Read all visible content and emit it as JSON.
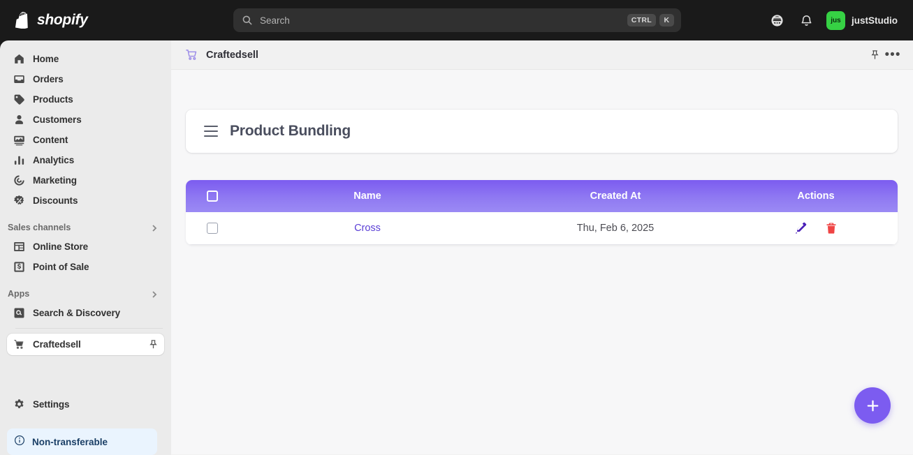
{
  "topbar": {
    "brand_name": "shopify",
    "brand_icon": "shopify-bag-logo",
    "search": {
      "placeholder": "Search",
      "icon": "search-icon",
      "kbd_ctrl": "CTRL",
      "kbd_key": "K"
    },
    "store_icon": "store-front-icon",
    "notifications_icon": "bell-icon",
    "user": {
      "initials": "jus",
      "name": "justStudio",
      "avatar_color": "#36d144"
    }
  },
  "sidebar": {
    "items": [
      {
        "label": "Home",
        "icon": "home-icon"
      },
      {
        "label": "Orders",
        "icon": "orders-inbox-icon"
      },
      {
        "label": "Products",
        "icon": "product-tag-icon"
      },
      {
        "label": "Customers",
        "icon": "person-icon"
      },
      {
        "label": "Content",
        "icon": "content-image-icon"
      },
      {
        "label": "Analytics",
        "icon": "bar-chart-icon"
      },
      {
        "label": "Marketing",
        "icon": "megaphone-target-icon"
      },
      {
        "label": "Discounts",
        "icon": "discount-percent-icon"
      }
    ],
    "sections": [
      {
        "title": "Sales channels",
        "chevron": "chevron-right-icon",
        "items": [
          {
            "label": "Online Store",
            "icon": "online-store-icon"
          },
          {
            "label": "Point of Sale",
            "icon": "point-of-sale-icon"
          }
        ]
      },
      {
        "title": "Apps",
        "chevron": "chevron-right-icon",
        "items": [
          {
            "label": "Search & Discovery",
            "icon": "search-square-icon"
          }
        ]
      }
    ],
    "active_app": {
      "label": "Craftedsell",
      "icon": "shopping-cart-icon",
      "pin_icon": "pin-icon"
    },
    "settings": {
      "label": "Settings",
      "icon": "gear-icon"
    },
    "banner": {
      "label": "Non-transferable",
      "icon": "info-circle-icon",
      "bg": "#eaf4fe",
      "fg": "#1b3f66"
    }
  },
  "content": {
    "breadcrumb": {
      "title": "Craftedsell",
      "icon": "shopping-cart-icon",
      "pin_icon": "pin-icon",
      "more_icon": "ellipsis-icon"
    },
    "page_card": {
      "title": "Product Bundling",
      "menu_icon": "hamburger-menu-icon"
    },
    "table": {
      "columns": [
        "",
        "Name",
        "Created At",
        "Actions"
      ],
      "header_gradient_from": "#7c5cf0",
      "header_gradient_to": "#9b8af4",
      "rows": [
        {
          "name": "Cross",
          "created_at": "Thu, Feb 6, 2025",
          "edit_icon": "pencil-icon",
          "delete_icon": "trash-icon",
          "edit_color": "#4b21b8",
          "delete_color": "#ef4444"
        }
      ]
    },
    "fab": {
      "icon": "plus-icon",
      "color": "#7c5cf0"
    }
  }
}
